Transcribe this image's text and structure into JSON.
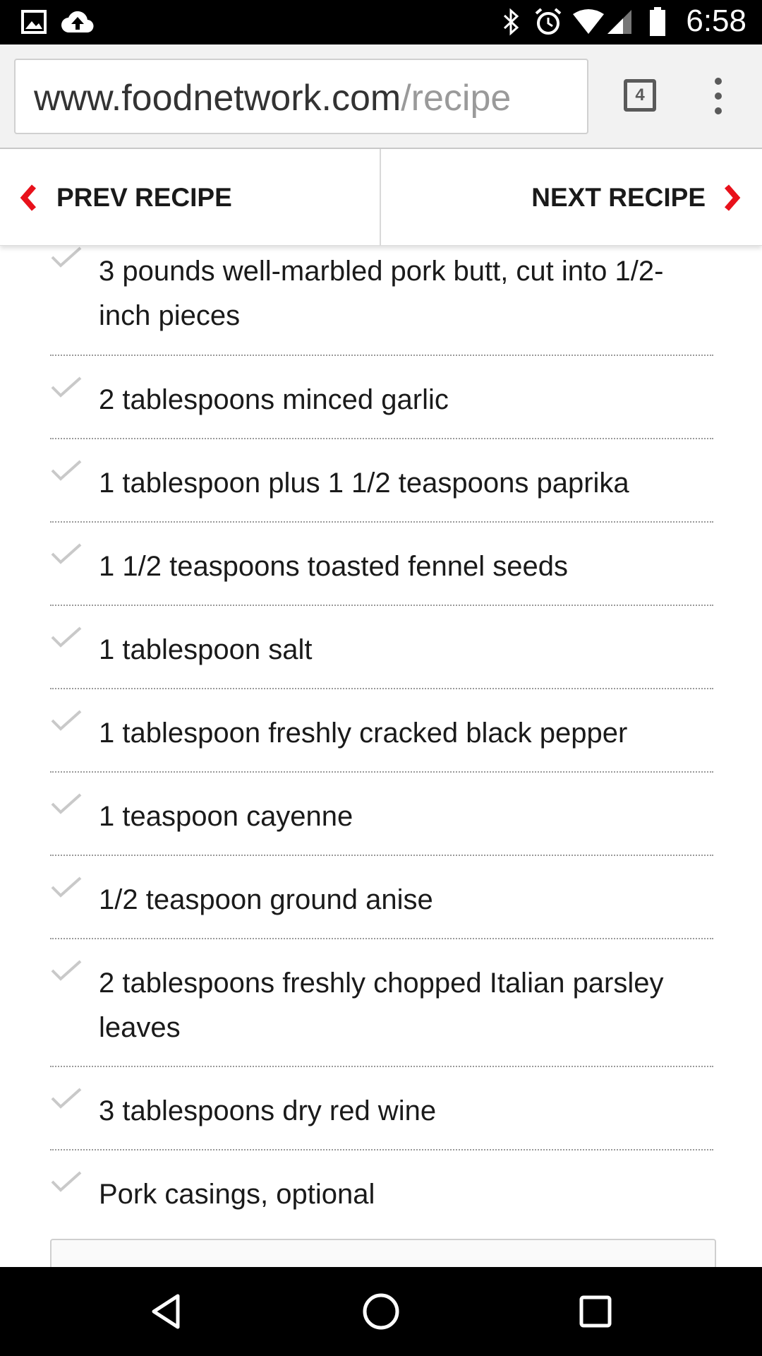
{
  "status_bar": {
    "time": "6:58",
    "icons": [
      "image-icon",
      "cloud-upload-icon",
      "bluetooth-icon",
      "alarm-icon",
      "wifi-icon",
      "cell-signal-icon",
      "battery-icon"
    ]
  },
  "browser": {
    "url_host": "www.foodnetwork.com",
    "url_path": "/recipe",
    "tab_count": "4"
  },
  "recipe_nav": {
    "prev_label": "PREV RECIPE",
    "next_label": "NEXT RECIPE",
    "accent_color": "#e8111b"
  },
  "ingredients": [
    "3 pounds well-marbled pork butt, cut into 1/2-inch pieces",
    "2 tablespoons minced garlic",
    "1 tablespoon plus 1 1/2 teaspoons paprika",
    "1 1/2 teaspoons toasted fennel seeds",
    "1 tablespoon salt",
    "1 tablespoon freshly cracked black pepper",
    "1 teaspoon cayenne",
    "1/2 teaspoon ground anise",
    "2 tablespoons freshly chopped Italian parsley leaves",
    "3 tablespoons dry red wine",
    "Pork casings, optional"
  ],
  "nav_bar": {
    "icons": [
      "back-icon",
      "home-icon",
      "recents-icon"
    ]
  }
}
